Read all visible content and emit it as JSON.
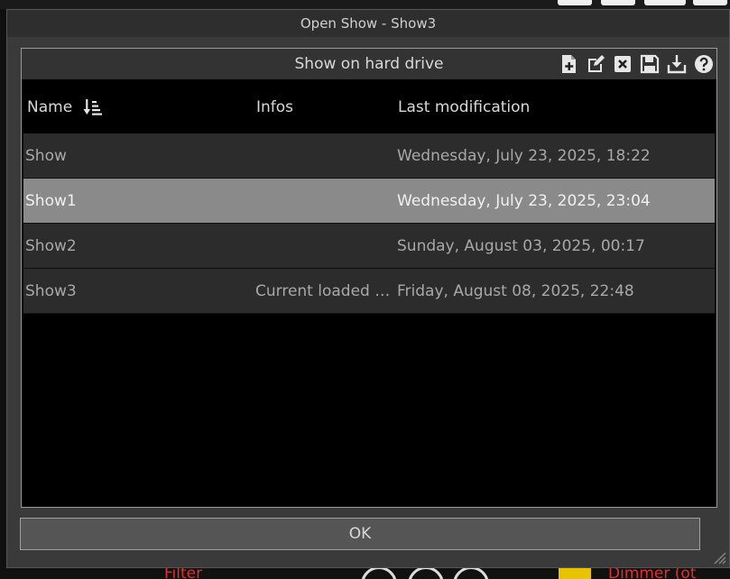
{
  "window": {
    "title": "Open Show - Show3"
  },
  "panel": {
    "title": "Show on hard drive",
    "toolbar": [
      {
        "name": "new-file-icon"
      },
      {
        "name": "edit-icon"
      },
      {
        "name": "delete-icon"
      },
      {
        "name": "save-icon"
      },
      {
        "name": "import-icon"
      },
      {
        "name": "help-icon"
      }
    ]
  },
  "table": {
    "columns": {
      "name": "Name",
      "infos": "Infos",
      "last": "Last modification"
    },
    "rows": [
      {
        "name": "Show",
        "infos": "",
        "date": "Wednesday, July 23, 2025, 18:22",
        "selected": false
      },
      {
        "name": "Show1",
        "infos": "",
        "date": "Wednesday, July 23, 2025, 23:04",
        "selected": true
      },
      {
        "name": "Show2",
        "infos": "",
        "date": "Sunday, August 03, 2025, 00:17",
        "selected": false
      },
      {
        "name": "Show3",
        "infos": "Current loaded …",
        "date": "Friday, August 08, 2025, 22:48",
        "selected": false
      }
    ]
  },
  "buttons": {
    "ok": "OK"
  },
  "background": {
    "left_label": "Filter",
    "right_label": "Dimmer (ot"
  },
  "colors": {
    "selected_row": "#8a8a8a",
    "row": "#2c2c2c",
    "accent_red": "#e03030"
  }
}
